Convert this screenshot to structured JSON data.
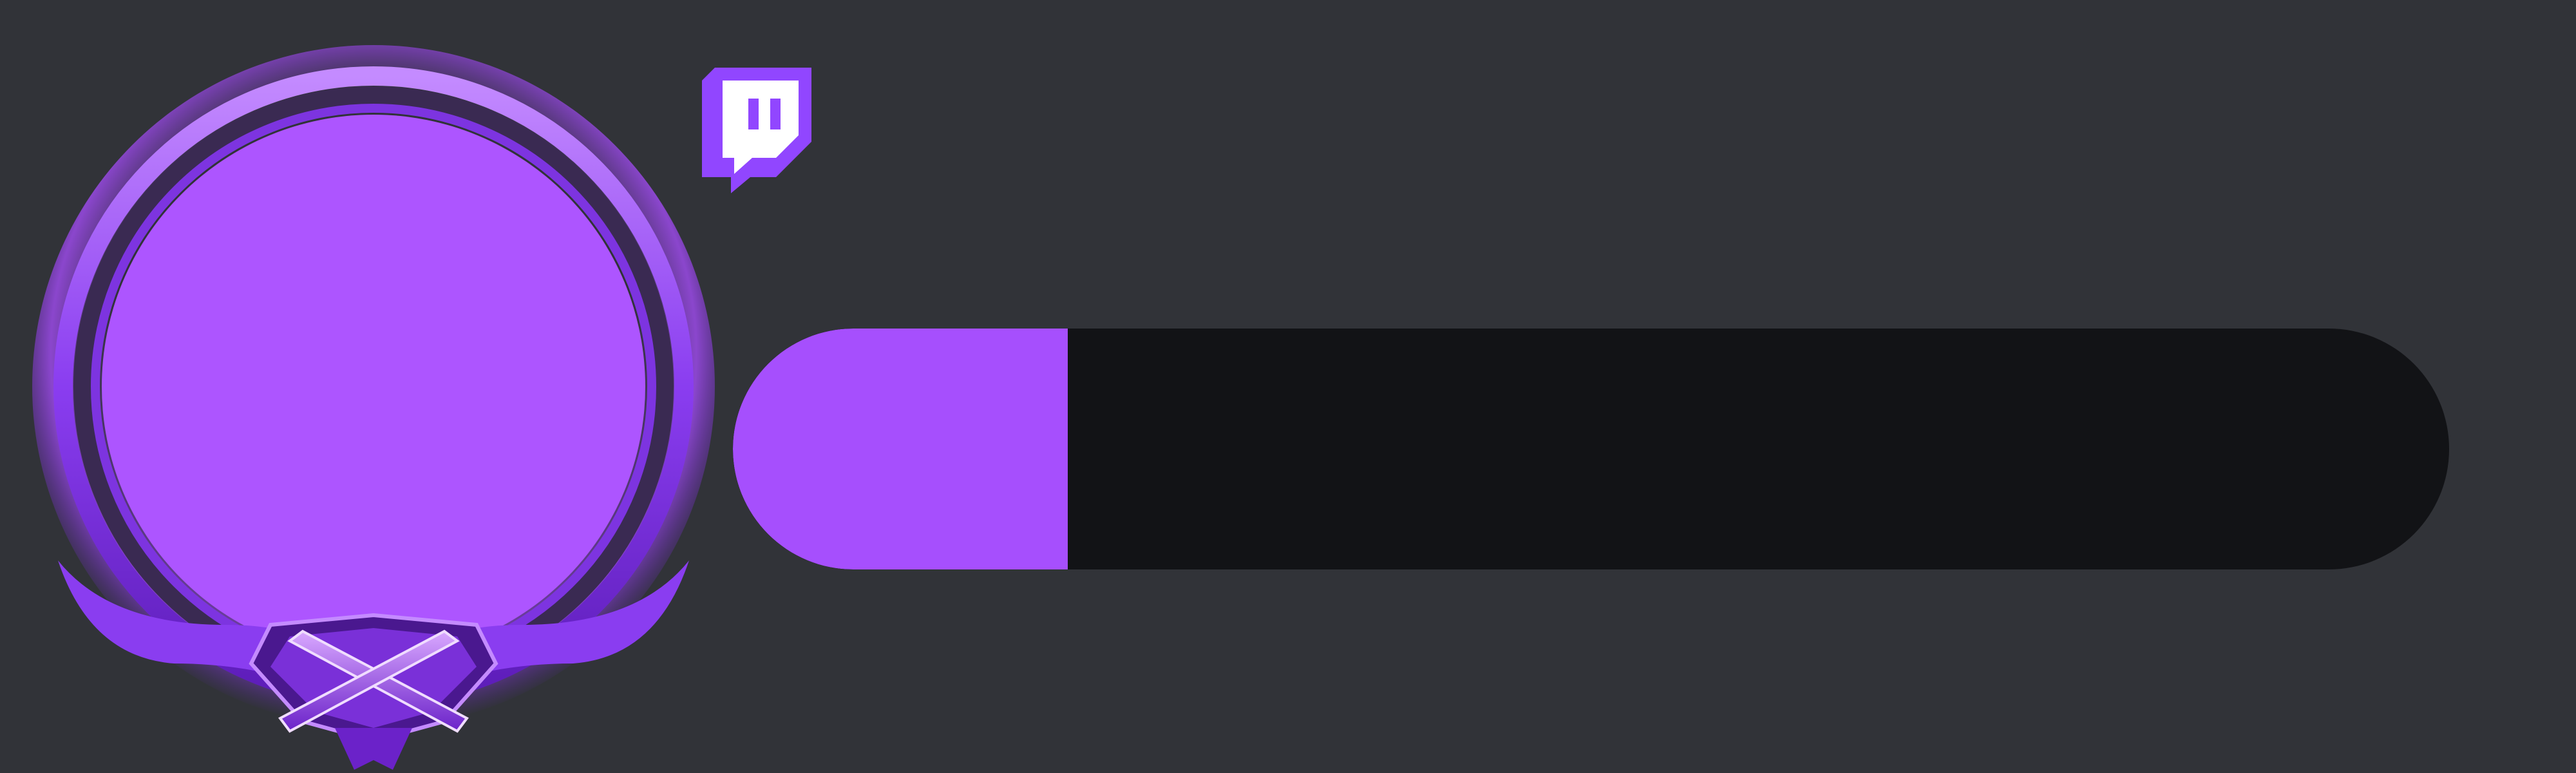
{
  "colors": {
    "background": "#313338",
    "accent": "#a64ffd",
    "avatar_fill": "#ad55ff",
    "track": "#121316",
    "twitch_brand": "#9146ff"
  },
  "icons": {
    "platform": "twitch-icon",
    "frame_emblem": "crossed-swords-icon"
  },
  "avatar": {
    "frame_style": "purple-flame-ring"
  },
  "progress": {
    "fraction": 0.195
  }
}
